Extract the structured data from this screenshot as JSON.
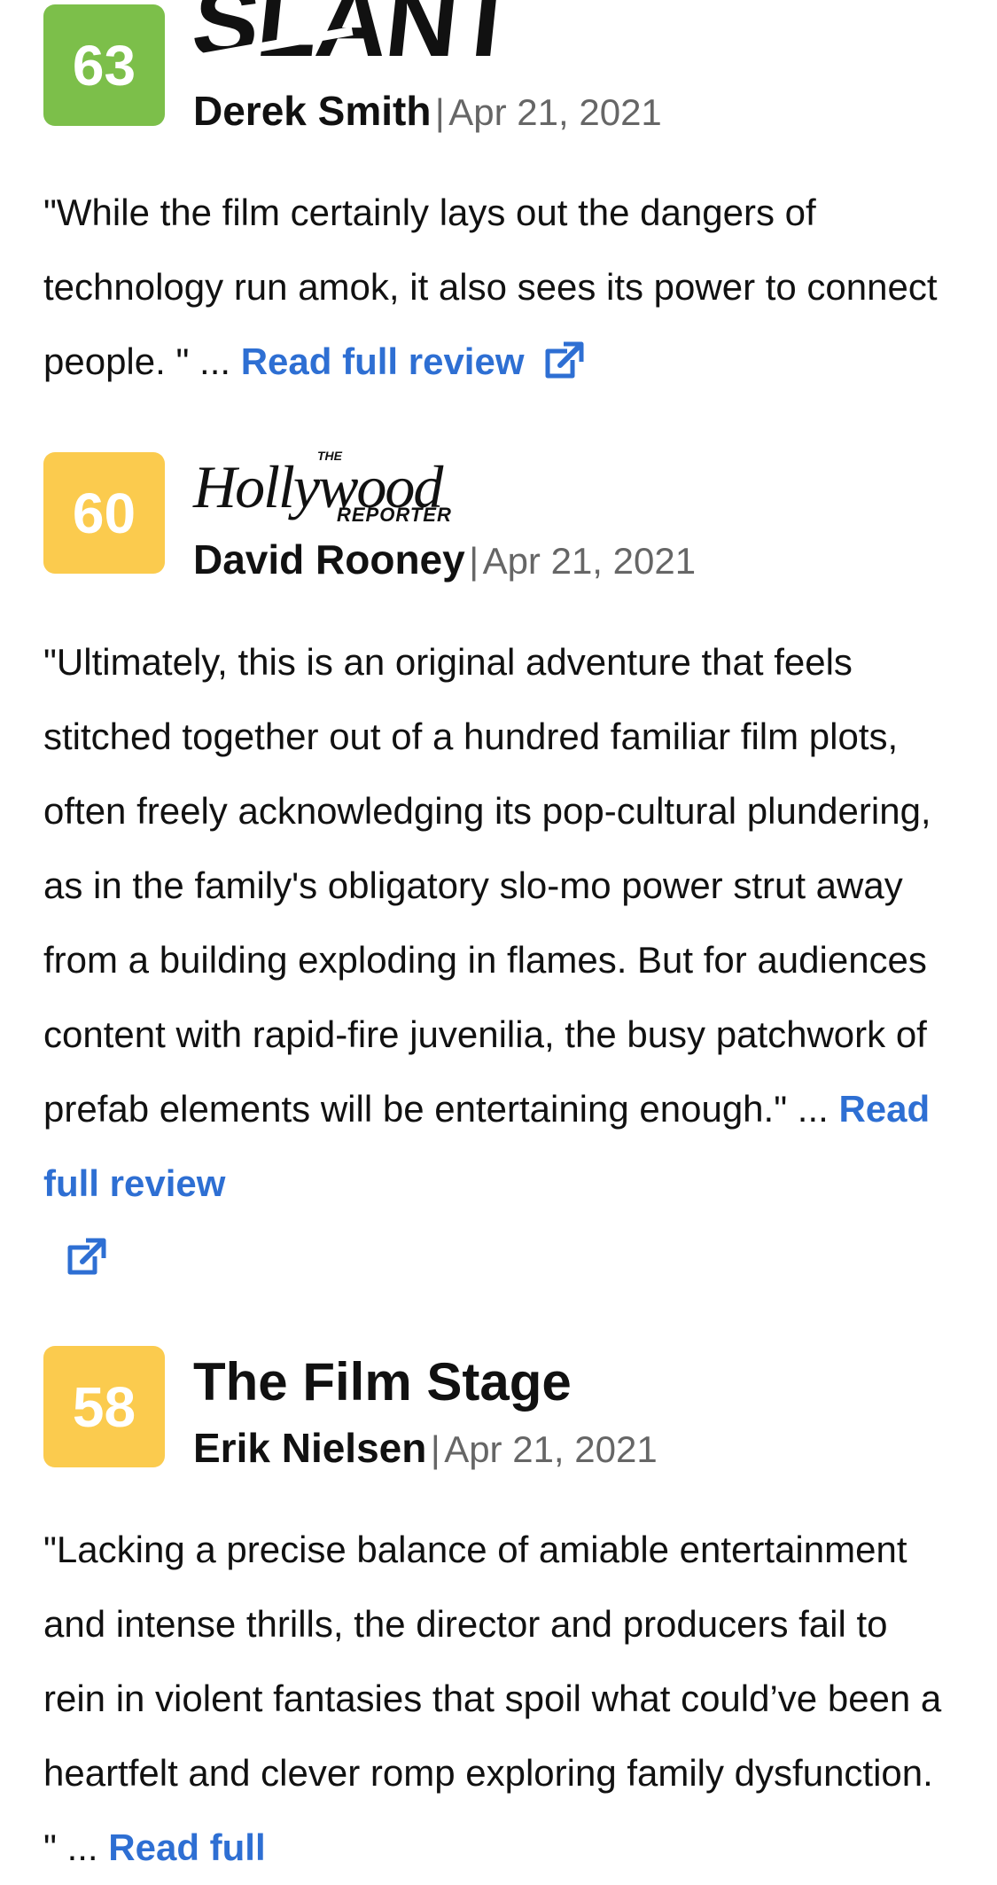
{
  "reviews": [
    {
      "score": "63",
      "score_color": "#7cbf4a",
      "publication": "SLANT",
      "critic": "Derek Smith",
      "separator": "|",
      "date": "Apr 21, 2021",
      "quote": "\"While the film certainly lays out the dangers of technology run amok, it also sees its power to connect people. \" ... ",
      "link_label": "Read full review",
      "link_icon": "external-link-icon"
    },
    {
      "score": "60",
      "score_color": "#fbcb4e",
      "publication": "Hollywood",
      "publication_the": "THE",
      "publication_reporter": "REPORTER",
      "critic": "David Rooney",
      "separator": "|",
      "date": "Apr 21, 2021",
      "quote": "\"Ultimately, this is an original adventure that feels stitched together out of a hundred familiar film plots, often freely acknowledging its pop-cultural plundering, as in the family's obligatory slo-mo power strut away from a building exploding in flames. But for audiences content with rapid-fire juvenilia, the busy patchwork of prefab elements will be entertaining enough.\" ... ",
      "link_label": "Read full review",
      "link_icon": "external-link-icon"
    },
    {
      "score": "58",
      "score_color": "#fbcb4e",
      "publication": "The Film Stage",
      "critic": "Erik Nielsen",
      "separator": "|",
      "date": "Apr 21, 2021",
      "quote": "\"Lacking a precise balance of amiable entertainment and intense thrills, the director and producers fail to rein in violent fantasies that spoil what could’ve been a heartfelt and clever romp exploring family dysfunction. \" ... ",
      "link_label": "Read full",
      "link_icon": "external-link-icon"
    }
  ],
  "colors": {
    "link": "#2e6fd3",
    "text": "#111111",
    "muted": "#666666"
  }
}
